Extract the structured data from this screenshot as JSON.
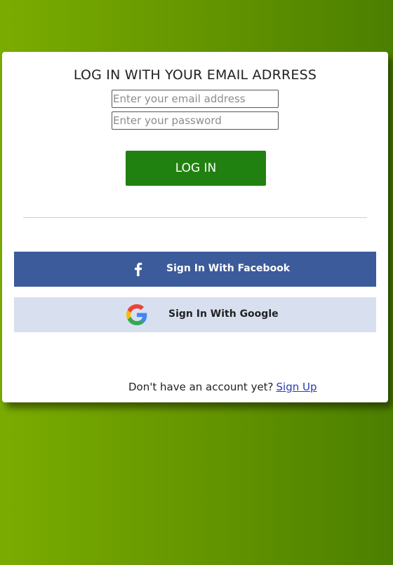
{
  "login": {
    "title": "LOG IN WITH YOUR EMAIL ADRRESS",
    "email_placeholder": "Enter your email address",
    "password_placeholder": "Enter your password",
    "button_label": "LOG IN"
  },
  "social": {
    "facebook_label": "Sign In With Facebook",
    "google_label": "Sign In With Google"
  },
  "footer": {
    "prompt": "Don't have an account yet?",
    "signup_link": "Sign Up"
  },
  "colors": {
    "login_button": "#218110",
    "facebook": "#3b5b9b",
    "google_bg": "#d8e0f0",
    "background_gradient": [
      "#7aac00",
      "#4c7f00"
    ]
  }
}
